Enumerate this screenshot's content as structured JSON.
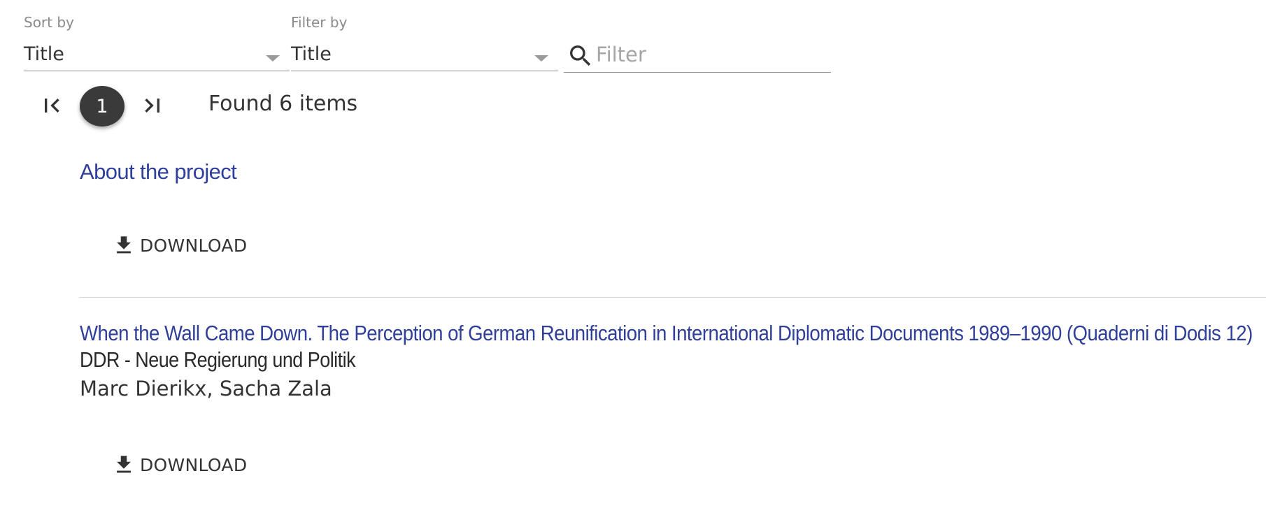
{
  "sort": {
    "label": "Sort by",
    "value": "Title"
  },
  "filter_by": {
    "label": "Filter by",
    "value": "Title"
  },
  "search": {
    "placeholder": "Filter",
    "value": ""
  },
  "pagination": {
    "current_page": "1",
    "found_text": "Found 6 items"
  },
  "items": [
    {
      "title": "About the project",
      "download_label": "DOWNLOAD"
    },
    {
      "title": "When the Wall Came Down. The Perception of German Reunification in International Diplomatic Documents 1989–1990 (Quaderni di Dodis 12)",
      "subtitle": "DDR - Neue Regierung und Politik",
      "authors": "Marc Dierikx, Sacha Zala",
      "download_label": "DOWNLOAD"
    }
  ],
  "colors": {
    "link": "#2f3f9a",
    "text": "#333333",
    "muted": "#8a8a8a",
    "page_badge": "#3a3a3a"
  }
}
